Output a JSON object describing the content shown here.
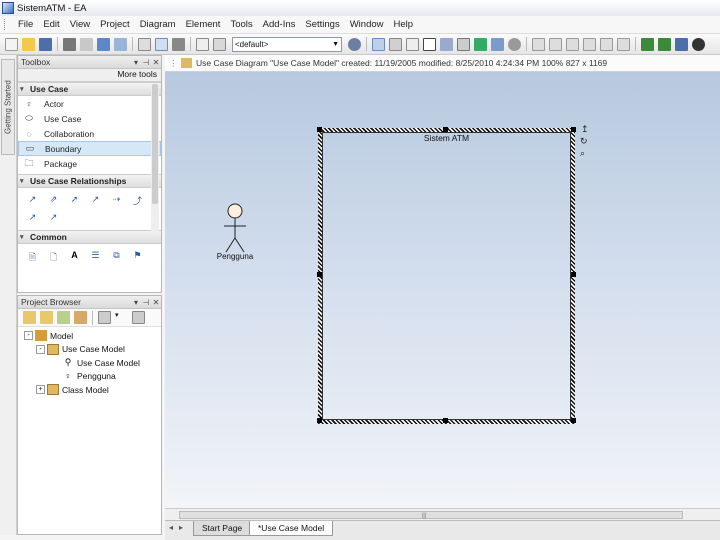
{
  "window": {
    "title": "SistemATM - EA"
  },
  "menu": [
    "File",
    "Edit",
    "View",
    "Project",
    "Diagram",
    "Element",
    "Tools",
    "Add-Ins",
    "Settings",
    "Window",
    "Help"
  ],
  "toolbar": {
    "combo_value": "<default>"
  },
  "sidebar": {
    "tab_label": "Getting Started"
  },
  "toolbox": {
    "title": "Toolbox",
    "more_tools": "More tools",
    "sections": [
      {
        "name": "Use Case",
        "items": [
          {
            "label": "Actor",
            "icon": "actor-icon"
          },
          {
            "label": "Use Case",
            "icon": "use-case-icon"
          },
          {
            "label": "Collaboration",
            "icon": "collaboration-icon"
          },
          {
            "label": "Boundary",
            "icon": "boundary-icon",
            "selected": true
          },
          {
            "label": "Package",
            "icon": "package-icon"
          }
        ]
      },
      {
        "name": "Use Case Relationships",
        "icons": [
          "association-icon",
          "generalize-icon",
          "include-icon",
          "extend-icon",
          "realize-icon",
          "dependency-icon",
          "invokes-icon",
          "precedes-icon"
        ]
      },
      {
        "name": "Common",
        "icons": [
          "note-icon",
          "artifact-icon",
          "text-icon",
          "hyperlink-icon",
          "constraint-icon",
          "legend-icon"
        ]
      }
    ]
  },
  "project_browser": {
    "title": "Project Browser",
    "tree": [
      {
        "label": "Model",
        "level": 0,
        "expander": "-"
      },
      {
        "label": "Use Case Model",
        "level": 1,
        "expander": "-"
      },
      {
        "label": "Use Case Model",
        "level": 2,
        "expander": ""
      },
      {
        "label": "Pengguna",
        "level": 2,
        "expander": ""
      },
      {
        "label": "Class Model",
        "level": 1,
        "expander": "+"
      }
    ]
  },
  "diagram": {
    "header": "Use Case Diagram \"Use Case Model\"  created: 11/19/2005  modified: 8/25/2010 4:24:34 PM  100%  827 x 1169",
    "boundary_label": "Sistem ATM",
    "actor_label": "Pengguna"
  },
  "tabs": [
    {
      "label": "Start Page",
      "active": false
    },
    {
      "label": "*Use Case Model",
      "active": true
    }
  ]
}
